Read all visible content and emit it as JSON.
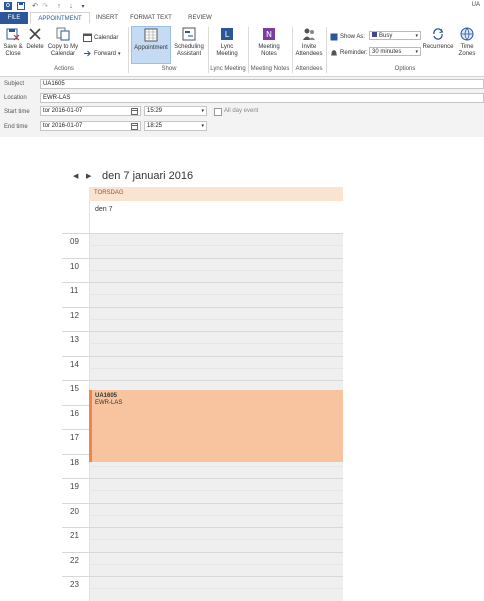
{
  "window": {
    "title": "UA"
  },
  "quick_access": {
    "icons": [
      "outlook-icon",
      "save-icon",
      "undo-icon",
      "redo-icon",
      "up-arrow-icon",
      "down-arrow-icon",
      "customize-icon"
    ]
  },
  "tabs": [
    "FILE",
    "APPOINTMENT",
    "INSERT",
    "FORMAT TEXT",
    "REVIEW"
  ],
  "ribbon": {
    "actions": {
      "save_close": "Save & Close",
      "delete": "Delete",
      "copy_calendar": "Copy to My Calendar",
      "calendar": "Calendar",
      "forward": "Forward",
      "group": "Actions"
    },
    "show": {
      "appointment": "Appointment",
      "scheduling": "Scheduling Assistant",
      "group": "Show"
    },
    "lync": {
      "label": "Lync Meeting",
      "group": "Lync Meeting"
    },
    "meeting_notes": {
      "label": "Meeting Notes",
      "group": "Meeting Notes"
    },
    "attendees": {
      "label": "Invite Attendees",
      "group": "Attendees"
    },
    "options": {
      "show_as_label": "Show As:",
      "show_as_value": "Busy",
      "reminder_label": "Reminder:",
      "reminder_value": "30 minutes",
      "recurrence": "Recurrence",
      "time_zones": "Time Zones",
      "group": "Options"
    }
  },
  "form": {
    "subject_label": "Subject",
    "subject": "UA1605",
    "location_label": "Location",
    "location": "EWR-LAS",
    "start_label": "Start time",
    "start_date": "tor 2016-01-07",
    "start_time": "15:29",
    "all_day_label": "All day event",
    "end_label": "End time",
    "end_date": "tor 2016-01-07",
    "end_time": "18:25"
  },
  "calendar": {
    "header_date": "den 7 januari 2016",
    "day_name": "TORSDAG",
    "day_label": "den 7",
    "hours": [
      "09",
      "10",
      "11",
      "12",
      "13",
      "14",
      "15",
      "16",
      "17",
      "18",
      "19",
      "20",
      "21",
      "22",
      "23"
    ],
    "event": {
      "title": "UA1605",
      "location": "EWR-LAS",
      "color": "#f8c4a0",
      "bar_color": "#e9884b"
    }
  },
  "colors": {
    "accent": "#2b579a",
    "selected_button": "#c5dbf3",
    "day_header": "#fbe3d2"
  }
}
